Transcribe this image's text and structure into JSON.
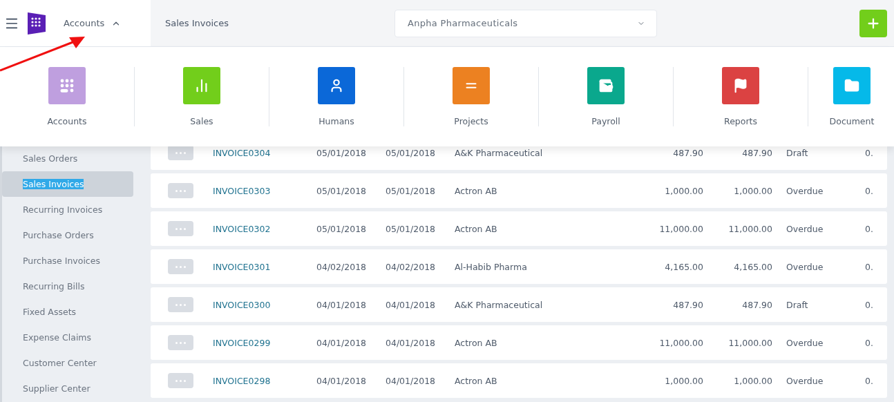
{
  "header": {
    "module": "Accounts",
    "page_title": "Sales Invoices",
    "company": "Anpha Pharmaceuticals"
  },
  "module_menu": [
    {
      "label": "Accounts",
      "color": "#bf9fdf"
    },
    {
      "label": "Sales",
      "color": "#72ce1b"
    },
    {
      "label": "Humans",
      "color": "#0b68d8"
    },
    {
      "label": "Projects",
      "color": "#ec8121"
    },
    {
      "label": "Payroll",
      "color": "#0aa88d"
    },
    {
      "label": "Reports",
      "color": "#db4242"
    },
    {
      "label": "Document",
      "color": "#05b9e9"
    }
  ],
  "sidebar": {
    "items": [
      {
        "label": "Sales Orders",
        "selected": false
      },
      {
        "label": "Sales Invoices",
        "selected": true
      },
      {
        "label": "Recurring Invoices",
        "selected": false
      },
      {
        "label": "Purchase Orders",
        "selected": false
      },
      {
        "label": "Purchase Invoices",
        "selected": false
      },
      {
        "label": "Recurring Bills",
        "selected": false
      },
      {
        "label": "Fixed Assets",
        "selected": false
      },
      {
        "label": "Expense Claims",
        "selected": false
      },
      {
        "label": "Customer Center",
        "selected": false
      },
      {
        "label": "Supplier Center",
        "selected": false
      }
    ]
  },
  "invoices": [
    {
      "number": "INVOICE0304",
      "date": "05/01/2018",
      "due_date": "05/01/2018",
      "customer": "A&K Pharmaceutical",
      "total": "487.90",
      "balance": "487.90",
      "status": "Draft",
      "column_9": "0."
    },
    {
      "number": "INVOICE0303",
      "date": "05/01/2018",
      "due_date": "05/01/2018",
      "customer": "Actron AB",
      "total": "1,000.00",
      "balance": "1,000.00",
      "status": "Overdue",
      "column_9": "0."
    },
    {
      "number": "INVOICE0302",
      "date": "05/01/2018",
      "due_date": "05/01/2018",
      "customer": "Actron AB",
      "total": "11,000.00",
      "balance": "11,000.00",
      "status": "Overdue",
      "column_9": "0."
    },
    {
      "number": "INVOICE0301",
      "date": "04/02/2018",
      "due_date": "04/02/2018",
      "customer": "Al-Habib Pharma",
      "total": "4,165.00",
      "balance": "4,165.00",
      "status": "Overdue",
      "column_9": "0."
    },
    {
      "number": "INVOICE0300",
      "date": "04/01/2018",
      "due_date": "04/01/2018",
      "customer": "A&K Pharmaceutical",
      "total": "487.90",
      "balance": "487.90",
      "status": "Draft",
      "column_9": "0."
    },
    {
      "number": "INVOICE0299",
      "date": "04/01/2018",
      "due_date": "04/01/2018",
      "customer": "Actron AB",
      "total": "11,000.00",
      "balance": "11,000.00",
      "status": "Overdue",
      "column_9": "0."
    },
    {
      "number": "INVOICE0298",
      "date": "04/01/2018",
      "due_date": "04/01/2018",
      "customer": "Actron AB",
      "total": "1,000.00",
      "balance": "1,000.00",
      "status": "Overdue",
      "column_9": "0."
    }
  ]
}
